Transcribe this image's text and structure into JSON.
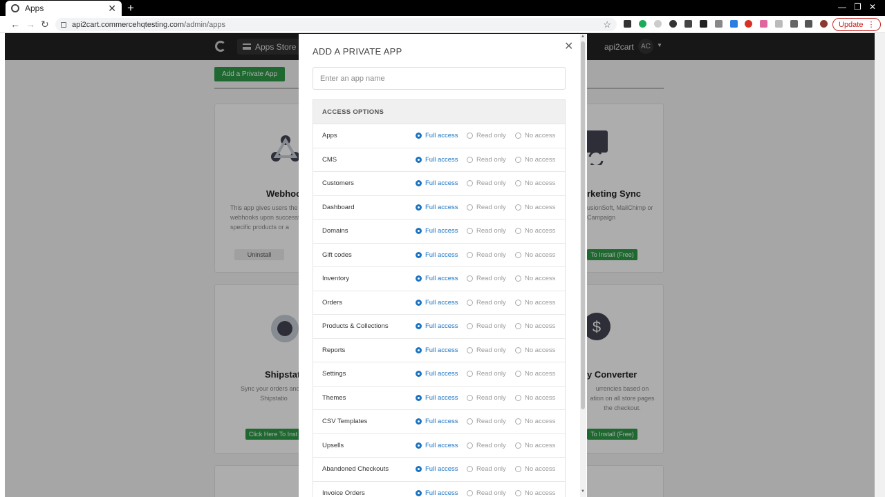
{
  "browser": {
    "tab_title": "Apps",
    "url_host": "api2cart.commercehqtesting.com",
    "url_path": "/admin/apps",
    "update_label": "Update"
  },
  "navbar": {
    "apps_store_label": "Apps Store",
    "user_name": "api2cart",
    "avatar_initials": "AC"
  },
  "page": {
    "add_private_app_label": "Add a Private App"
  },
  "cards": [
    {
      "title": "Webhook",
      "desc": [
        "This app gives users the a",
        "webhooks upon successf",
        "specific products or a"
      ],
      "button": "Uninstall"
    },
    {
      "title": "rketing Sync",
      "desc": [
        "usionSoft, MailChimp or",
        "Campaign"
      ],
      "button": "To Install (Free)"
    },
    {
      "title": "Shipstatio",
      "desc": [
        "Sync your orders and pr",
        "Shipstatio"
      ],
      "button": "Click Here To Inst"
    },
    {
      "title": "y Converter",
      "desc": [
        "urrencies based on",
        "ation on all store pages",
        "the checkout."
      ],
      "button": "To Install (Free)"
    }
  ],
  "modal": {
    "title": "ADD A PRIVATE APP",
    "name_placeholder": "Enter an app name",
    "name_value": "",
    "access_header": "ACCESS OPTIONS",
    "option_labels": [
      "Full access",
      "Read only",
      "No access"
    ],
    "rows": [
      {
        "label": "Apps",
        "selected": "Full access"
      },
      {
        "label": "CMS",
        "selected": "Full access"
      },
      {
        "label": "Customers",
        "selected": "Full access"
      },
      {
        "label": "Dashboard",
        "selected": "Full access"
      },
      {
        "label": "Domains",
        "selected": "Full access"
      },
      {
        "label": "Gift codes",
        "selected": "Full access"
      },
      {
        "label": "Inventory",
        "selected": "Full access"
      },
      {
        "label": "Orders",
        "selected": "Full access"
      },
      {
        "label": "Products & Collections",
        "selected": "Full access"
      },
      {
        "label": "Reports",
        "selected": "Full access"
      },
      {
        "label": "Settings",
        "selected": "Full access"
      },
      {
        "label": "Themes",
        "selected": "Full access"
      },
      {
        "label": "CSV Templates",
        "selected": "Full access"
      },
      {
        "label": "Upsells",
        "selected": "Full access"
      },
      {
        "label": "Abandoned Checkouts",
        "selected": "Full access"
      },
      {
        "label": "Invoice Orders",
        "selected": "Full access"
      }
    ]
  },
  "colors": {
    "accent_blue": "#1a73c2",
    "install_green": "#2e9b49",
    "navbar_dark": "#222222"
  }
}
